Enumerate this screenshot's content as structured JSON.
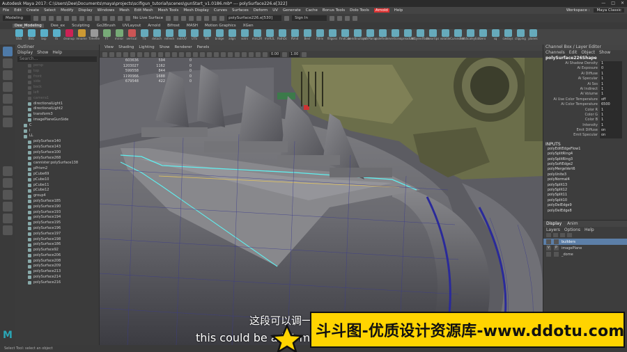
{
  "window": {
    "title": "Autodesk Maya 2017: C:\\Users\\Dee\\Documents\\maya\\projects\\scifigun_tutorial\\scenes\\gunStart_v1.0186.mb* --- polySurface226.e[322]",
    "controls": [
      "—",
      "□",
      "✕"
    ]
  },
  "menubar": {
    "items": [
      "File",
      "Edit",
      "Create",
      "Select",
      "Modify",
      "Display",
      "Windows",
      "Mesh",
      "Edit Mesh",
      "Mesh Tools",
      "Mesh Display",
      "Curves",
      "Surfaces",
      "Deform",
      "UV",
      "Generate",
      "Cache",
      "Bonus Tools",
      "Dolo Tools"
    ],
    "arnold": "Arnold",
    "help": "Help",
    "workspace_label": "Workspace :",
    "workspace_value": "Maya Classic"
  },
  "statusline": {
    "mode": "Modeling",
    "live_surface": "No Live Surface",
    "name_field": "polySurface226.e[530]",
    "sign_in": "Sign In"
  },
  "shelf_tabs": [
    "Dee_Modeling",
    "Dee_ex",
    "Sculpting",
    "Go2Brush",
    "UVLayout",
    "Arnold",
    "Bifrost",
    "MASH",
    "Motion Graphics",
    "XGen"
  ],
  "shelf_active_tab": "Dee_Modeling",
  "shelf_items": [
    {
      "label": "OSS",
      "color": "#5ab0c9"
    },
    {
      "label": "BSG",
      "color": "#5ab0c9"
    },
    {
      "label": "bsp",
      "color": "#5ab0c9"
    },
    {
      "label": "IS",
      "color": "#5ab0c9"
    },
    {
      "label": "cleanup",
      "color": "#c25"
    },
    {
      "label": "rename",
      "color": "#c93"
    },
    {
      "label": "Timefile",
      "color": "#999"
    },
    {
      "label": "FT",
      "color": "#7a7"
    },
    {
      "label": "mirror",
      "color": "#7a7"
    },
    {
      "label": "vertical",
      "color": "#c55"
    },
    {
      "label": "TS",
      "color": "#6ab"
    },
    {
      "label": "detach",
      "color": "#6ab"
    },
    {
      "label": "refresh",
      "color": "#6ab"
    },
    {
      "label": "extrUV",
      "color": "#6ab"
    },
    {
      "label": "UTS",
      "color": "#6ab"
    },
    {
      "label": "SM",
      "color": "#6ab"
    },
    {
      "label": "bridge",
      "color": "#6ab"
    },
    {
      "label": "align",
      "color": "#6ab"
    },
    {
      "label": "sotrs",
      "color": "#6ab"
    },
    {
      "label": "mirL2R",
      "color": "#6ab"
    },
    {
      "label": "mirR2L",
      "color": "#6ab"
    },
    {
      "label": "PathDc",
      "color": "#6ab"
    },
    {
      "label": "RVnd",
      "color": "#6ab"
    },
    {
      "label": "Bevl",
      "color": "#6ab"
    },
    {
      "label": "FBrix",
      "color": "#6ab"
    },
    {
      "label": "fillgons",
      "color": "#6ab"
    },
    {
      "label": "FindCan",
      "color": "#6ab"
    },
    {
      "label": "bendtnuitomi",
      "color": "#6ab"
    },
    {
      "label": "pchPlanar",
      "color": "#6ab"
    },
    {
      "label": "polefinder",
      "color": "#6ab"
    },
    {
      "label": "vertices",
      "color": "#6ab"
    },
    {
      "label": "spreadUVs",
      "color": "#6ab"
    },
    {
      "label": "ab5yendTools",
      "color": "#6ab"
    },
    {
      "label": "lineartips",
      "color": "#6ab"
    },
    {
      "label": "volatile",
      "color": "#6ab"
    },
    {
      "label": "CurvesEdit",
      "color": "#6ab"
    },
    {
      "label": "zeroScaleyEdit",
      "color": "#6ab"
    },
    {
      "label": "zero",
      "color": "#6ab"
    },
    {
      "label": "sq",
      "color": "#6ab"
    },
    {
      "label": "cwdays",
      "color": "#6ab"
    },
    {
      "label": "clipping",
      "color": "#6ab"
    },
    {
      "label": "planes",
      "color": "#6ab"
    }
  ],
  "outliner": {
    "title": "Outliner",
    "menu": [
      "Display",
      "Show",
      "Help"
    ],
    "search_placeholder": "Search...",
    "items": [
      {
        "label": "persp",
        "dim": true
      },
      {
        "label": "top",
        "dim": true
      },
      {
        "label": "front",
        "dim": true
      },
      {
        "label": "side",
        "dim": true
      },
      {
        "label": "back",
        "dim": true
      },
      {
        "label": "left",
        "dim": true
      },
      {
        "label": "camera1",
        "dim": true
      },
      {
        "label": "directionalLight1",
        "dim": false
      },
      {
        "label": "directionalLight2",
        "dim": false
      },
      {
        "label": "transform3",
        "dim": false
      },
      {
        "label": "imagePlaneGunSide",
        "dim": false
      },
      {
        "label": "C",
        "dim": false
      },
      {
        "label": "I",
        "dim": false
      },
      {
        "label": "LL",
        "dim": false
      },
      {
        "label": "polySurface140",
        "dim": false
      },
      {
        "label": "polySurface143",
        "dim": false
      },
      {
        "label": "polySurface100",
        "dim": false
      },
      {
        "label": "polySurface268",
        "dim": false
      },
      {
        "label": "cannister:polySurface138",
        "dim": false
      },
      {
        "label": "pPrism2",
        "dim": false
      },
      {
        "label": "pCube69",
        "dim": false
      },
      {
        "label": "pCube10",
        "dim": false
      },
      {
        "label": "pCube11",
        "dim": false
      },
      {
        "label": "pCube12",
        "dim": false
      },
      {
        "label": "group4",
        "dim": false
      },
      {
        "label": "polySurface185",
        "dim": false
      },
      {
        "label": "polySurface190",
        "dim": false
      },
      {
        "label": "polySurface193",
        "dim": false
      },
      {
        "label": "polySurface194",
        "dim": false
      },
      {
        "label": "polySurface195",
        "dim": false
      },
      {
        "label": "polySurface196",
        "dim": false
      },
      {
        "label": "polySurface197",
        "dim": false
      },
      {
        "label": "polySurface198",
        "dim": false
      },
      {
        "label": "polySurface186",
        "dim": false
      },
      {
        "label": "polySurface92",
        "dim": false
      },
      {
        "label": "polySurface206",
        "dim": false
      },
      {
        "label": "polySurface208",
        "dim": false
      },
      {
        "label": "polySurface209",
        "dim": false
      },
      {
        "label": "polySurface213",
        "dim": false
      },
      {
        "label": "polySurface214",
        "dim": false
      },
      {
        "label": "polySurface216",
        "dim": false
      }
    ]
  },
  "viewport": {
    "menu": [
      "View",
      "Shading",
      "Lighting",
      "Show",
      "Renderer",
      "Panels"
    ],
    "fields": [
      "0.00",
      "1.00"
    ],
    "hud_rows": [
      [
        "603636",
        "594",
        "0"
      ],
      [
        "1203027",
        "1162",
        "0"
      ],
      [
        "599558",
        "844",
        "0"
      ],
      [
        "1199966",
        "1688",
        "0"
      ],
      [
        "679548",
        "422",
        "0"
      ]
    ]
  },
  "channelbox": {
    "title": "Channel Box / Layer Editor",
    "menu": [
      "Channels",
      "Edit",
      "Object",
      "Show"
    ],
    "object": "polySurface226Shape",
    "attributes": [
      {
        "name": "Ai Shadow Density",
        "value": "1"
      },
      {
        "name": "Ai Exposure",
        "value": "0"
      },
      {
        "name": "Ai Diffuse",
        "value": "1"
      },
      {
        "name": "Ai Specular",
        "value": "1"
      },
      {
        "name": "Ai Sss",
        "value": "1"
      },
      {
        "name": "Ai Indirect",
        "value": "1"
      },
      {
        "name": "Ai Volume",
        "value": "1"
      },
      {
        "name": "Ai Use Color Temperature",
        "value": "off"
      },
      {
        "name": "Ai Color Temperature",
        "value": "6500"
      },
      {
        "name": "Color R",
        "value": "1"
      },
      {
        "name": "Color G",
        "value": "1"
      },
      {
        "name": "Color B",
        "value": "1"
      },
      {
        "name": "Intensity",
        "value": "1"
      },
      {
        "name": "Emit Diffuse",
        "value": "on"
      },
      {
        "name": "Emit Specular",
        "value": "on"
      }
    ],
    "inputs_header": "INPUTS",
    "inputs": [
      "polyEditEdgeFlow1",
      "polySplitRing4",
      "polySplitRing3",
      "polySoftEdge2",
      "polyMergeVert6",
      "polyUnite3",
      "polyNormal4",
      "polySplit13",
      "polySplit12",
      "polySplit11",
      "polySplit10",
      "polyDelEdge9",
      "polyDelEdge8"
    ]
  },
  "layers": {
    "tabs": [
      "Display",
      "Anim"
    ],
    "menu": [
      "Layers",
      "Options",
      "Help"
    ],
    "rows": [
      {
        "v": "",
        "p": "",
        "name": "builders",
        "selected": true
      },
      {
        "v": "V",
        "p": "P",
        "name": "imagePlane",
        "selected": false
      },
      {
        "v": "",
        "p": "",
        "name": "_dome",
        "selected": false
      }
    ]
  },
  "helpline": "Select Tool: select an object",
  "subtitles": {
    "chinese": "这段可以调一下",
    "english": "this could be a bit more"
  },
  "watermark": "斗斗图-优质设计资源库-www.ddotu.com",
  "maya_logo": "M"
}
